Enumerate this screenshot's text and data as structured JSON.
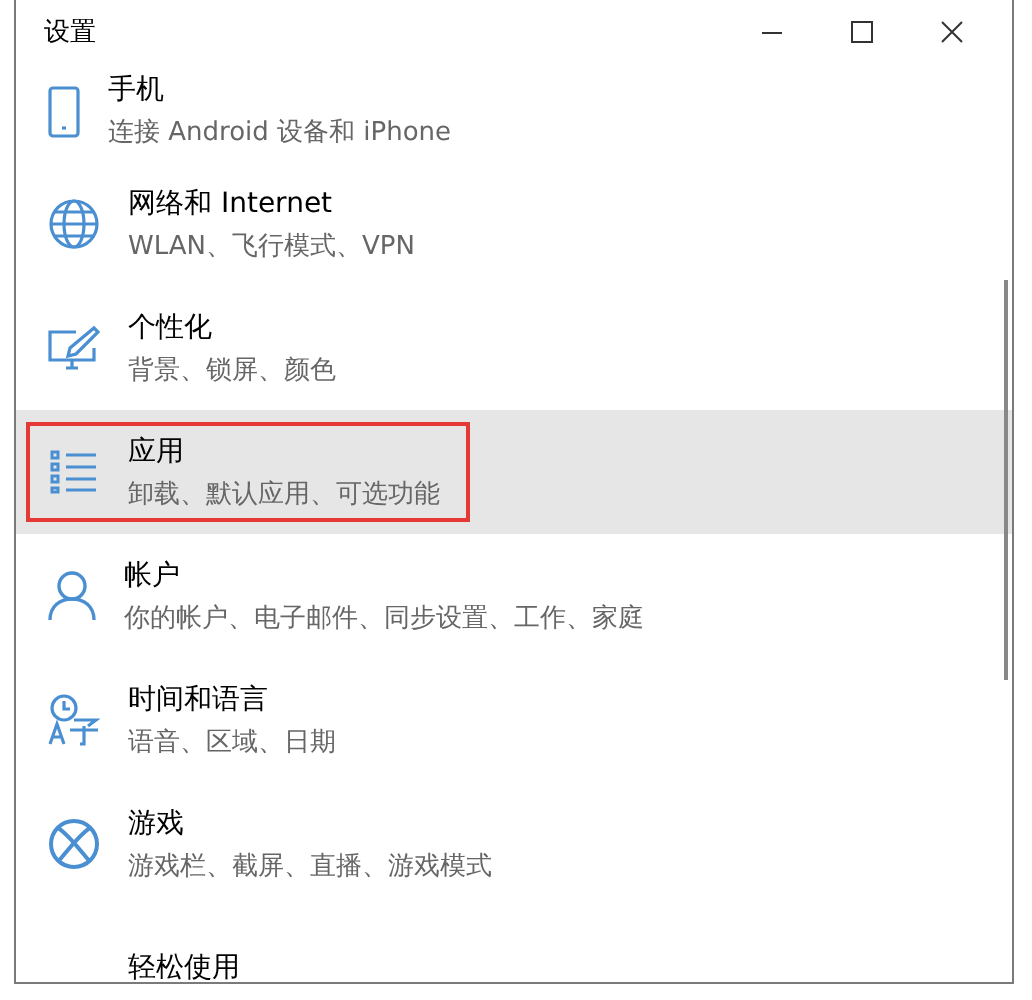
{
  "window": {
    "title": "设置"
  },
  "items": [
    {
      "kind": "phone",
      "title": "手机",
      "subtitle": "连接 Android 设备和 iPhone",
      "selected": false,
      "highlighted": false
    },
    {
      "kind": "globe",
      "title": "网络和 Internet",
      "subtitle": "WLAN、飞行模式、VPN",
      "selected": false,
      "highlighted": false
    },
    {
      "kind": "brush",
      "title": "个性化",
      "subtitle": "背景、锁屏、颜色",
      "selected": false,
      "highlighted": false
    },
    {
      "kind": "apps",
      "title": "应用",
      "subtitle": "卸载、默认应用、可选功能",
      "selected": true,
      "highlighted": true
    },
    {
      "kind": "person",
      "title": "帐户",
      "subtitle": "你的帐户、电子邮件、同步设置、工作、家庭",
      "selected": false,
      "highlighted": false
    },
    {
      "kind": "language",
      "title": "时间和语言",
      "subtitle": "语音、区域、日期",
      "selected": false,
      "highlighted": false
    },
    {
      "kind": "xbox",
      "title": "游戏",
      "subtitle": "游戏栏、截屏、直播、游戏模式",
      "selected": false,
      "highlighted": false
    },
    {
      "kind": "none",
      "title": "轻松使用",
      "selected": false,
      "highlighted": false
    }
  ]
}
